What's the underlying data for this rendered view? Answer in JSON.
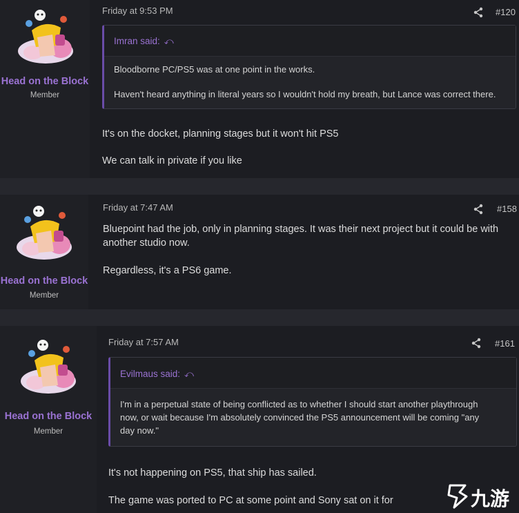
{
  "posts": [
    {
      "author": "Head on the Block",
      "role": "Member",
      "date": "Friday at 9:53 PM",
      "post_number": "#120",
      "quote": {
        "author": "Imran said:",
        "lines": [
          "Bloodborne PC/PS5 was at one point in the works.",
          "Haven't heard anything in literal years so I wouldn't hold my breath, but Lance was correct there."
        ]
      },
      "body": [
        "It's on the docket, planning stages but it won't hit PS5",
        "We can talk in private if you like"
      ]
    },
    {
      "author": "Head on the Block",
      "role": "Member",
      "date": "Friday at 7:47 AM",
      "post_number": "#158",
      "body": [
        "Bluepoint had the job, only in planning stages. It was their next project but it could be with",
        "another studio now.",
        "Regardless, it's a PS6 game."
      ]
    },
    {
      "author": "Head on the Block",
      "role": "Member",
      "date": "Friday at 7:57 AM",
      "post_number": "#161",
      "quote": {
        "author": "Evilmaus said:",
        "lines": [
          "I'm in a perpetual state of being conflicted as to whether I should start another playthrough",
          "now, or wait because I'm absolutely convinced the PS5 announcement will be coming \"any",
          "day now.\""
        ]
      },
      "body": [
        "It's not happening on PS5, that ship has sailed.",
        "The game was ported to PC at some point and Sony sat on it for"
      ]
    }
  ],
  "watermark": {
    "text": "九游",
    "logo_color": "#ffffff"
  },
  "colors": {
    "accent": "#9a72d2",
    "quote_bar": "#6a4ca8",
    "post_bg": "#1c1d22",
    "page_bg": "#26272d"
  }
}
